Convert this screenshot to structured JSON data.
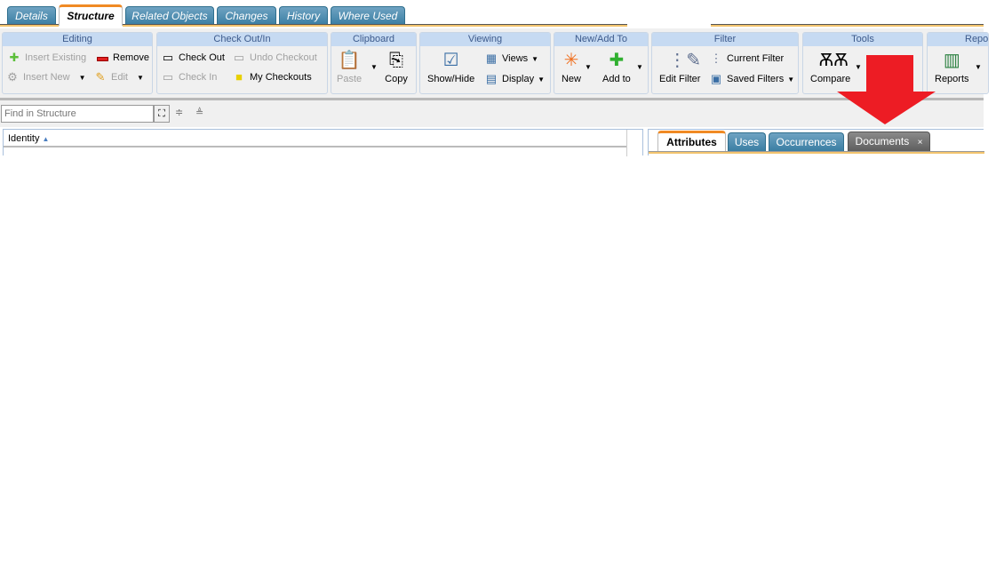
{
  "tabs": [
    "Details",
    "Structure",
    "Related Objects",
    "Changes",
    "History",
    "Where Used"
  ],
  "active_tab": "Structure",
  "ribbon": {
    "editing": {
      "title": "Editing",
      "insert_existing": "Insert Existing",
      "remove": "Remove",
      "insert_new": "Insert New",
      "edit": "Edit"
    },
    "checkout": {
      "title": "Check Out/In",
      "check_out": "Check Out",
      "undo_checkout": "Undo Checkout",
      "check_in": "Check In",
      "my_checkouts": "My Checkouts"
    },
    "clipboard": {
      "title": "Clipboard",
      "paste": "Paste",
      "copy": "Copy"
    },
    "viewing": {
      "title": "Viewing",
      "show_hide": "Show/Hide",
      "views": "Views",
      "display": "Display"
    },
    "new_add": {
      "title": "New/Add To",
      "new": "New",
      "add_to": "Add to"
    },
    "filter": {
      "title": "Filter",
      "edit_filter": "Edit Filter",
      "current_filter": "Current Filter",
      "saved_filters": "Saved Filters"
    },
    "tools": {
      "title": "Tools",
      "compare": "Compare"
    },
    "reports": {
      "title": "Repo",
      "reports": "Reports"
    }
  },
  "find": {
    "placeholder": "Find in Structure"
  },
  "tree": {
    "column": "Identity"
  },
  "right_tabs": [
    "Attributes",
    "Uses",
    "Occurrences",
    "Documents"
  ],
  "close_glyph": "×",
  "annotation": {
    "arrow_color": "#ed1c24"
  }
}
